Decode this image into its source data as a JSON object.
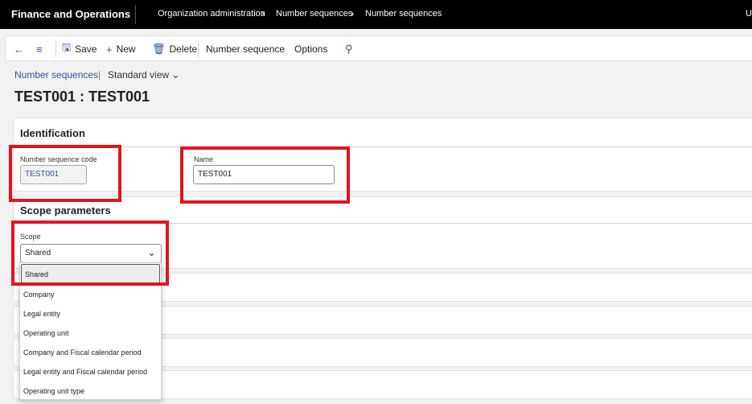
{
  "app": {
    "title": "Finance and Operations",
    "user_initial": "U"
  },
  "breadcrumb": [
    "Organization administration",
    "Number sequences",
    "Number sequences"
  ],
  "actions": {
    "save": "Save",
    "new": "New",
    "delete": "Delete",
    "number_sequence": "Number sequence",
    "options": "Options"
  },
  "subnav": {
    "link": "Number sequences",
    "separator": "|",
    "view": "Standard view"
  },
  "page_title": "TEST001 : TEST001",
  "identification": {
    "title": "Identification",
    "code_label": "Number sequence code",
    "code_value": "TEST001",
    "name_label": "Name",
    "name_value": "TEST001"
  },
  "scope": {
    "title": "Scope parameters",
    "label": "Scope",
    "value": "Shared",
    "options": [
      "Shared",
      "Company",
      "Legal entity",
      "Operating unit",
      "Company and Fiscal calendar period",
      "Legal entity and Fiscal calendar period",
      "Operating unit type"
    ]
  },
  "colors": {
    "accent": "#2b579a",
    "highlight": "#e3141c",
    "topbar": "#000000"
  }
}
